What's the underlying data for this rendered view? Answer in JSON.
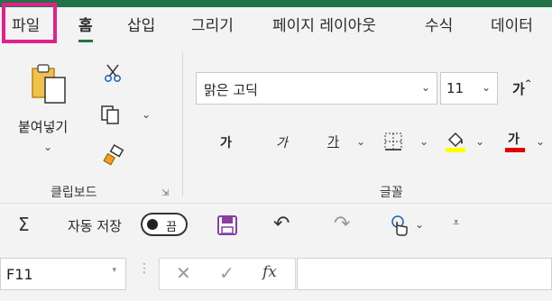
{
  "tabs": [
    "파일",
    "홈",
    "삽입",
    "그리기",
    "페이지 레이아웃",
    "수식",
    "데이터"
  ],
  "clipboard": {
    "paste_label": "붙여넣기",
    "group_label": "클립보드"
  },
  "font": {
    "name_value": "맑은 고딕",
    "size_value": "11",
    "increase_size_glyph": "가",
    "bold_glyph": "가",
    "italic_glyph": "가",
    "underline_glyph": "가",
    "font_color_glyph": "가",
    "group_label": "글꼴"
  },
  "qat": {
    "autosave_label": "자동 저장",
    "toggle_state": "끔"
  },
  "formula_bar": {
    "name_box_value": "F11",
    "fx_label": "fx"
  },
  "colors": {
    "excel_green": "#217346",
    "highlight_pink": "#e0218a",
    "fill_yellow": "#ffff00",
    "font_red": "#e00000",
    "save_purple": "#8a3fa0"
  }
}
